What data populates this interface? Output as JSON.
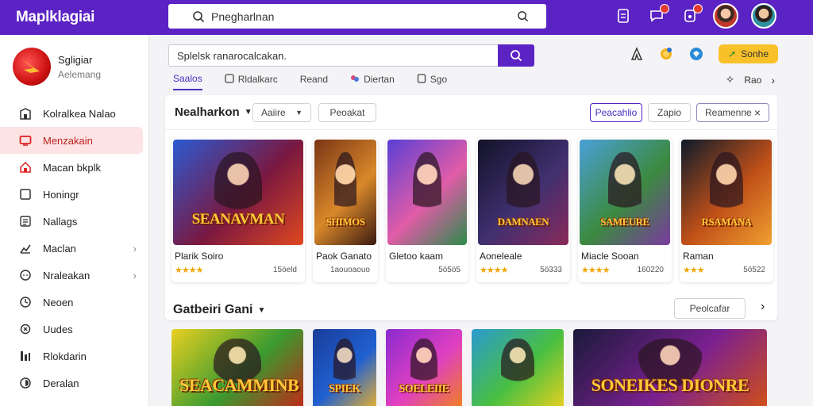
{
  "topbar": {
    "brand": "Maplklagiai",
    "search_value": "Pnegharlnan",
    "colors": {
      "bar": "#5b22c4",
      "badge": "#e53a2f"
    }
  },
  "sidebar": {
    "profile_name": "Sgligiar",
    "profile_sub": "Aelemang",
    "items": [
      {
        "label": "Kolralkea Nalao",
        "icon": "building-icon"
      },
      {
        "label": "Menzakain",
        "icon": "tv-icon",
        "active": true
      },
      {
        "label": "Macan bkplk",
        "icon": "house-icon"
      },
      {
        "label": "Honingr",
        "icon": "square-icon"
      },
      {
        "label": "Nallags",
        "icon": "list-icon"
      },
      {
        "label": "Maclan",
        "icon": "chart-icon",
        "chevron": "›"
      },
      {
        "label": "Nraleakan",
        "icon": "chat-icon",
        "chevron": "›"
      },
      {
        "label": "Neoen",
        "icon": "clock-icon"
      },
      {
        "label": "Uudes",
        "icon": "gear-icon"
      },
      {
        "label": "Rlokdarin",
        "icon": "bars-icon"
      },
      {
        "label": "Deralan",
        "icon": "circle-icon"
      }
    ]
  },
  "main": {
    "search_value": "Splelsk ranarocalcakan.",
    "tabs": [
      {
        "label": "Saalos",
        "icon": "",
        "active": true
      },
      {
        "label": "Rldalkarc",
        "icon": "grid-icon"
      },
      {
        "label": "Reand",
        "icon": ""
      },
      {
        "label": "Diertan",
        "icon": "puzzle-icon"
      },
      {
        "label": "Sgo",
        "icon": "page-icon"
      }
    ],
    "promo_label": "Sonhe",
    "right_link": "Rao",
    "featured": {
      "title": "Nealharkon",
      "filter1": "Aaiire",
      "filter2": "Peoakat",
      "btn_primary": "Peacahlio",
      "btn_secondary": "Zapio",
      "btn_third": "Reamenne",
      "close": "×",
      "cards": [
        {
          "title": "Plarik Soiro",
          "stars": "★★★★",
          "count": "15öeld",
          "art_text": "SEANAVMAN",
          "bg": [
            "#2c5ad2",
            "#7a1840",
            "#e04820"
          ]
        },
        {
          "title": "Paok Ganato",
          "stars": "",
          "count": "1aouoaouo",
          "art_text": "SHIMOS",
          "bg": [
            "#7a3515",
            "#d8882a",
            "#3b1a10"
          ]
        },
        {
          "title": "Gletoo kaam",
          "stars": "",
          "count": "5ö5ö5",
          "art_text": "",
          "bg": [
            "#5a3fd6",
            "#e05ca8",
            "#2b8c4a"
          ]
        },
        {
          "title": "Aoneleale",
          "stars": "★★★★",
          "count": "5ö333",
          "art_text": "DAMNAEN",
          "bg": [
            "#121228",
            "#403070",
            "#8a2a5a"
          ]
        },
        {
          "title": "Miacle Sooan",
          "stars": "★★★★",
          "count": "160220",
          "art_text": "SAMEURE",
          "bg": [
            "#4aa0d8",
            "#3c8a40",
            "#7a3aa0"
          ]
        },
        {
          "title": "Raman",
          "stars": "★★★",
          "count": "5ö522",
          "art_text": "RSAMANA",
          "bg": [
            "#0d1a2a",
            "#c05018",
            "#f0a030"
          ]
        }
      ]
    },
    "second": {
      "title": "Gatbeiri Gani",
      "button": "Peolcafar",
      "cards": [
        {
          "art_text": "SEACAMMINB",
          "bg": [
            "#e8d020",
            "#3a9a30",
            "#c02818"
          ],
          "w": 166
        },
        {
          "art_text": "SPIEK",
          "bg": [
            "#1a3c9a",
            "#2060d0",
            "#e8b030"
          ],
          "w": 80
        },
        {
          "art_text": "SOELEIIE",
          "bg": [
            "#8a2ad0",
            "#e040c0",
            "#f08020"
          ],
          "w": 96
        },
        {
          "art_text": "",
          "bg": [
            "#2a9ad0",
            "#4ac040",
            "#e8d020"
          ],
          "w": 116
        },
        {
          "art_text": "SONEIKES DIONRE",
          "bg": [
            "#1a1a3a",
            "#7a2090",
            "#d05018"
          ],
          "w": 244
        }
      ]
    }
  }
}
